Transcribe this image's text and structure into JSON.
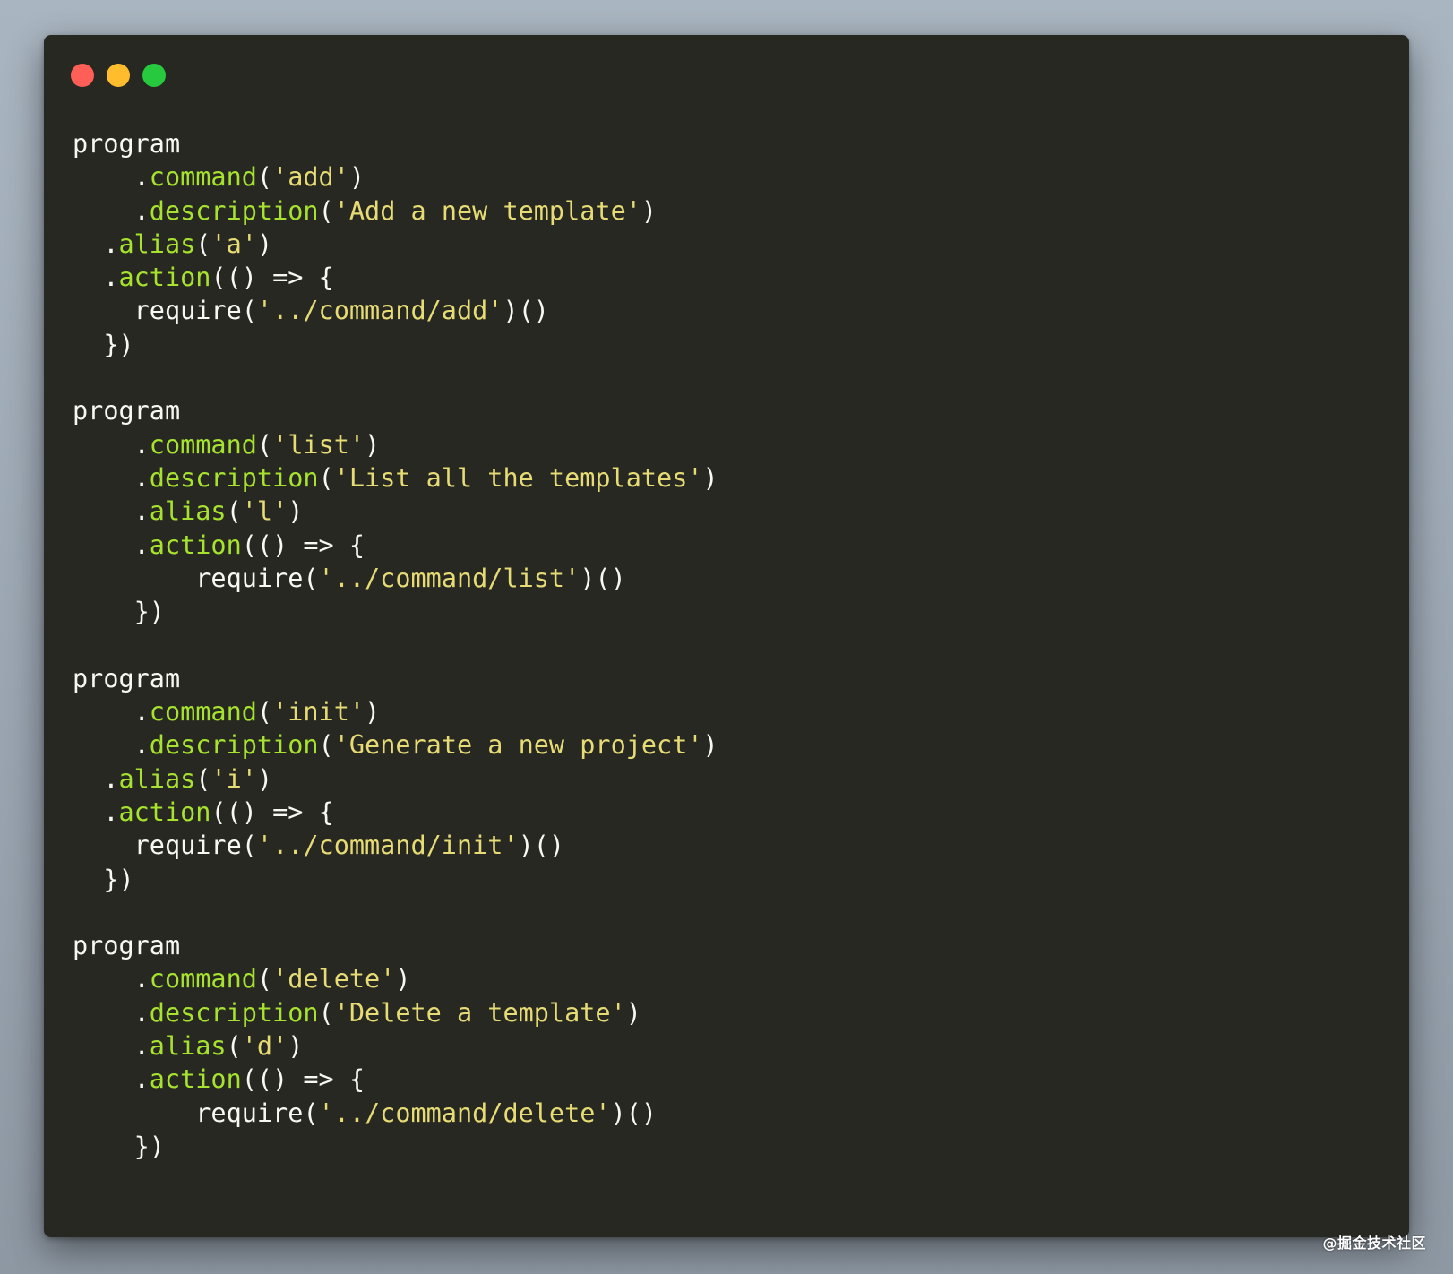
{
  "window": {
    "controls": [
      {
        "name": "close-button",
        "color": "#ff5f56"
      },
      {
        "name": "minimize-button",
        "color": "#ffbd2e"
      },
      {
        "name": "zoom-button",
        "color": "#27c93f"
      }
    ]
  },
  "code": {
    "language": "javascript",
    "lines": [
      [
        {
          "t": "program",
          "c": "plain"
        }
      ],
      [
        {
          "t": "    .",
          "c": "plain"
        },
        {
          "t": "command",
          "c": "method"
        },
        {
          "t": "(",
          "c": "plain"
        },
        {
          "t": "'add'",
          "c": "string"
        },
        {
          "t": ")",
          "c": "plain"
        }
      ],
      [
        {
          "t": "    .",
          "c": "plain"
        },
        {
          "t": "description",
          "c": "method"
        },
        {
          "t": "(",
          "c": "plain"
        },
        {
          "t": "'Add a new template'",
          "c": "string"
        },
        {
          "t": ")",
          "c": "plain"
        }
      ],
      [
        {
          "t": "  .",
          "c": "plain"
        },
        {
          "t": "alias",
          "c": "method"
        },
        {
          "t": "(",
          "c": "plain"
        },
        {
          "t": "'a'",
          "c": "string"
        },
        {
          "t": ")",
          "c": "plain"
        }
      ],
      [
        {
          "t": "  .",
          "c": "plain"
        },
        {
          "t": "action",
          "c": "method"
        },
        {
          "t": "(() => {",
          "c": "plain"
        }
      ],
      [
        {
          "t": "    require(",
          "c": "plain"
        },
        {
          "t": "'../command/add'",
          "c": "string"
        },
        {
          "t": ")()",
          "c": "plain"
        }
      ],
      [
        {
          "t": "  })",
          "c": "plain"
        }
      ],
      [],
      [
        {
          "t": "program",
          "c": "plain"
        }
      ],
      [
        {
          "t": "    .",
          "c": "plain"
        },
        {
          "t": "command",
          "c": "method"
        },
        {
          "t": "(",
          "c": "plain"
        },
        {
          "t": "'list'",
          "c": "string"
        },
        {
          "t": ")",
          "c": "plain"
        }
      ],
      [
        {
          "t": "    .",
          "c": "plain"
        },
        {
          "t": "description",
          "c": "method"
        },
        {
          "t": "(",
          "c": "plain"
        },
        {
          "t": "'List all the templates'",
          "c": "string"
        },
        {
          "t": ")",
          "c": "plain"
        }
      ],
      [
        {
          "t": "    .",
          "c": "plain"
        },
        {
          "t": "alias",
          "c": "method"
        },
        {
          "t": "(",
          "c": "plain"
        },
        {
          "t": "'l'",
          "c": "string"
        },
        {
          "t": ")",
          "c": "plain"
        }
      ],
      [
        {
          "t": "    .",
          "c": "plain"
        },
        {
          "t": "action",
          "c": "method"
        },
        {
          "t": "(() => {",
          "c": "plain"
        }
      ],
      [
        {
          "t": "        require(",
          "c": "plain"
        },
        {
          "t": "'../command/list'",
          "c": "string"
        },
        {
          "t": ")()",
          "c": "plain"
        }
      ],
      [
        {
          "t": "    })",
          "c": "plain"
        }
      ],
      [],
      [
        {
          "t": "program",
          "c": "plain"
        }
      ],
      [
        {
          "t": "    .",
          "c": "plain"
        },
        {
          "t": "command",
          "c": "method"
        },
        {
          "t": "(",
          "c": "plain"
        },
        {
          "t": "'init'",
          "c": "string"
        },
        {
          "t": ")",
          "c": "plain"
        }
      ],
      [
        {
          "t": "    .",
          "c": "plain"
        },
        {
          "t": "description",
          "c": "method"
        },
        {
          "t": "(",
          "c": "plain"
        },
        {
          "t": "'Generate a new project'",
          "c": "string"
        },
        {
          "t": ")",
          "c": "plain"
        }
      ],
      [
        {
          "t": "  .",
          "c": "plain"
        },
        {
          "t": "alias",
          "c": "method"
        },
        {
          "t": "(",
          "c": "plain"
        },
        {
          "t": "'i'",
          "c": "string"
        },
        {
          "t": ")",
          "c": "plain"
        }
      ],
      [
        {
          "t": "  .",
          "c": "plain"
        },
        {
          "t": "action",
          "c": "method"
        },
        {
          "t": "(() => {",
          "c": "plain"
        }
      ],
      [
        {
          "t": "    require(",
          "c": "plain"
        },
        {
          "t": "'../command/init'",
          "c": "string"
        },
        {
          "t": ")()",
          "c": "plain"
        }
      ],
      [
        {
          "t": "  })",
          "c": "plain"
        }
      ],
      [],
      [
        {
          "t": "program",
          "c": "plain"
        }
      ],
      [
        {
          "t": "    .",
          "c": "plain"
        },
        {
          "t": "command",
          "c": "method"
        },
        {
          "t": "(",
          "c": "plain"
        },
        {
          "t": "'delete'",
          "c": "string"
        },
        {
          "t": ")",
          "c": "plain"
        }
      ],
      [
        {
          "t": "    .",
          "c": "plain"
        },
        {
          "t": "description",
          "c": "method"
        },
        {
          "t": "(",
          "c": "plain"
        },
        {
          "t": "'Delete a template'",
          "c": "string"
        },
        {
          "t": ")",
          "c": "plain"
        }
      ],
      [
        {
          "t": "    .",
          "c": "plain"
        },
        {
          "t": "alias",
          "c": "method"
        },
        {
          "t": "(",
          "c": "plain"
        },
        {
          "t": "'d'",
          "c": "string"
        },
        {
          "t": ")",
          "c": "plain"
        }
      ],
      [
        {
          "t": "    .",
          "c": "plain"
        },
        {
          "t": "action",
          "c": "method"
        },
        {
          "t": "(() => {",
          "c": "plain"
        }
      ],
      [
        {
          "t": "        require(",
          "c": "plain"
        },
        {
          "t": "'../command/delete'",
          "c": "string"
        },
        {
          "t": ")()",
          "c": "plain"
        }
      ],
      [
        {
          "t": "    })",
          "c": "plain"
        }
      ]
    ]
  },
  "colors": {
    "background": "#272822",
    "plain": "#f8f8f2",
    "method": "#a6e22e",
    "string": "#e6db74"
  },
  "watermark": "@掘金技术社区"
}
